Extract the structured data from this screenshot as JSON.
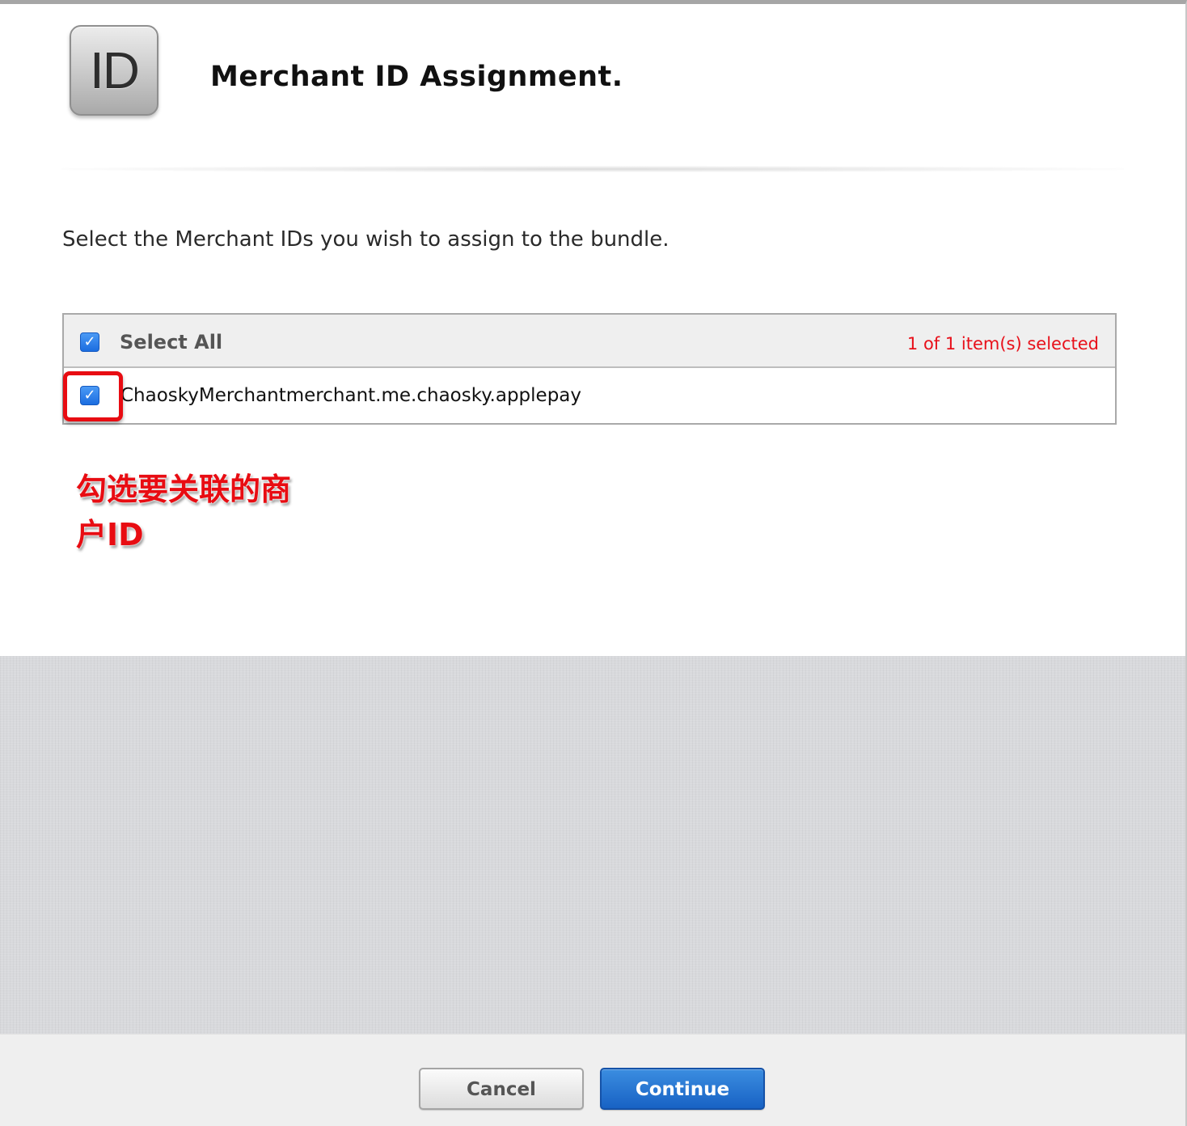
{
  "header": {
    "logo_text": "ID",
    "title": "Merchant ID Assignment."
  },
  "instruction": "Select the Merchant IDs you wish to assign to the bundle.",
  "table": {
    "select_all_label": "Select All",
    "select_all_checked": true,
    "selected_count_text": "1 of 1 item(s) selected",
    "rows": [
      {
        "label": "ChaoskyMerchantmerchant.me.chaosky.applepay",
        "checked": true
      }
    ]
  },
  "annotation": {
    "line1": "勾选要关联的商",
    "line2": "户ID",
    "color": "#e80c12"
  },
  "footer": {
    "cancel_label": "Cancel",
    "continue_label": "Continue"
  },
  "colors": {
    "accent_blue": "#1b6de0",
    "count_red": "#e8101a",
    "backdrop_gray": "#d8d9dc"
  }
}
